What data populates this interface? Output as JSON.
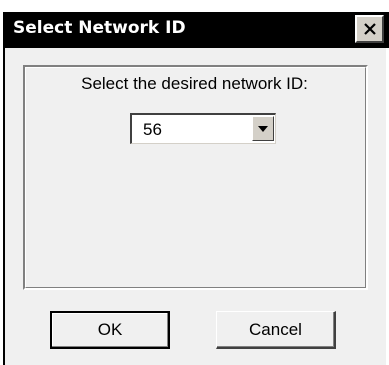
{
  "window": {
    "title": "Select Network ID",
    "close_icon": "close-icon"
  },
  "dialog": {
    "prompt": "Select the desired network ID:",
    "network_id": {
      "selected_value": "56",
      "arrow_icon": "chevron-down-icon"
    }
  },
  "buttons": {
    "ok_label": "OK",
    "cancel_label": "Cancel"
  },
  "colors": {
    "titlebar": "#000000",
    "title_text": "#ffffff",
    "face": "#f0f0f0"
  }
}
